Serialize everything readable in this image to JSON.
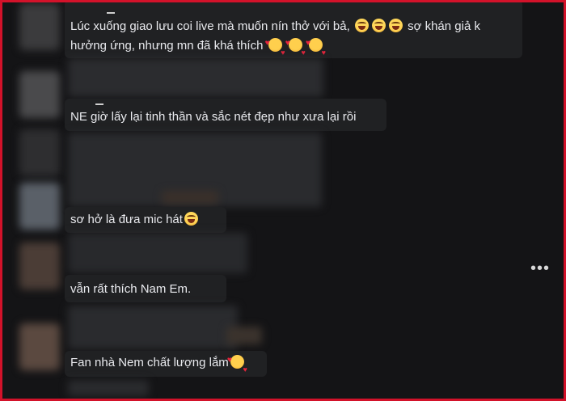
{
  "comments": [
    {
      "text": "Lúc xuống giao lưu coi live mà muốn nín thở với bả,",
      "emojis_after": [
        "grinning-sweat-emoji",
        "grinning-sweat-emoji",
        "grinning-sweat-emoji"
      ],
      "text2": "sợ khán giả k",
      "line2": "hưởng ứng, nhưng mn đã khá thích",
      "emojis_line2": [
        "smiling-face-with-hearts-emoji",
        "smiling-face-with-hearts-emoji",
        "smiling-face-with-hearts-emoji"
      ]
    },
    {
      "text": "NE giờ lấy lại tinh thần và sắc nét đẹp như xưa lại rồi"
    },
    {
      "text": "sơ hở là đưa mic hát",
      "emoji": "grinning-sweat-emoji"
    },
    {
      "text": "vẫn rất thích Nam Em."
    },
    {
      "text": "Fan nhà Nem chất lượng lắm",
      "emoji": "smiling-face-with-hearts-emoji"
    }
  ],
  "more_options": "•••",
  "colors": {
    "frame": "#d3122a",
    "background": "#141416",
    "bubble": "#202123"
  }
}
